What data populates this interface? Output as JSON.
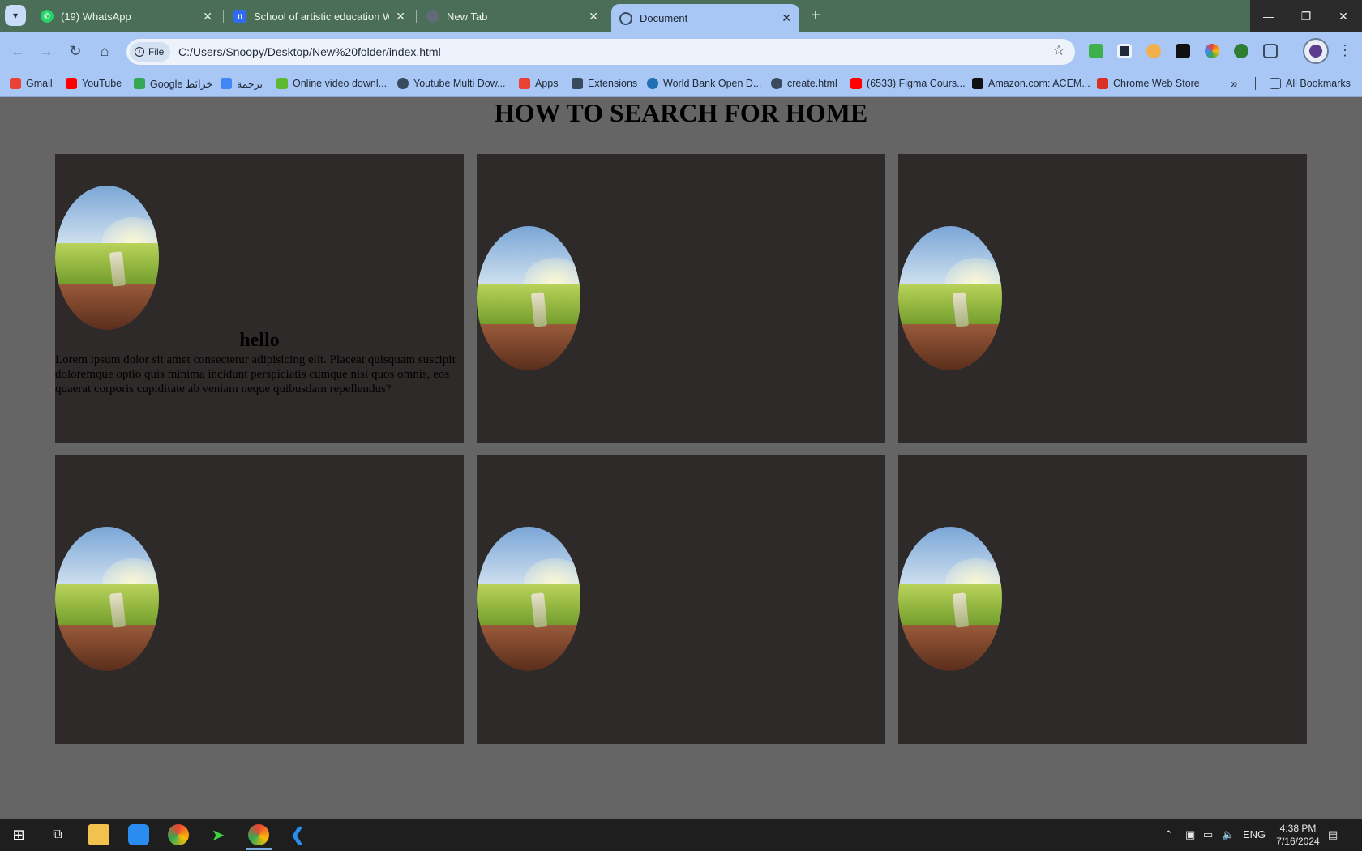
{
  "browser": {
    "tabs": [
      {
        "title": "(19) WhatsApp",
        "icon": "whatsapp-icon",
        "color": "#25d366"
      },
      {
        "title": "School of artistic education Wel",
        "icon": "notion-like-icon",
        "color": "#2f6bf0"
      },
      {
        "title": "New Tab",
        "icon": "globe-icon",
        "color": "#5f6b76"
      },
      {
        "title": "Document",
        "icon": "globe-icon",
        "color": "#3a4a5d"
      }
    ],
    "address_chip": "File",
    "url": "C:/Users/Snoopy/Desktop/New%20folder/index.html",
    "bookmarks": [
      {
        "label": "Gmail",
        "color": "#ea4335"
      },
      {
        "label": "YouTube",
        "color": "#ff0000"
      },
      {
        "label": "Google خرائط",
        "color": "#34a853"
      },
      {
        "label": "ترجمة",
        "color": "#4285f4"
      },
      {
        "label": "Online video downl...",
        "color": "#5fb832"
      },
      {
        "label": "Youtube Multi Dow...",
        "color": "#3a4a5d"
      },
      {
        "label": "Apps",
        "color": "#e94235"
      },
      {
        "label": "Extensions",
        "color": "#3a4a5d"
      },
      {
        "label": "World Bank Open D...",
        "color": "#1f6fb5"
      },
      {
        "label": "create.html",
        "color": "#3a4a5d"
      },
      {
        "label": "(6533) Figma Cours...",
        "color": "#ff0000"
      },
      {
        "label": "Amazon.com: ACEM...",
        "color": "#111111"
      },
      {
        "label": "Chrome Web Store",
        "color": "#d93025"
      }
    ],
    "all_bookmarks": "All Bookmarks"
  },
  "page": {
    "title": "HOW TO SEARCH FOR HOME",
    "cards": [
      {
        "heading": "hello",
        "text": "Lorem ipsum dolor sit amet consectetur adipisicing elit. Placeat quisquam suscipit doloremque optio quis minima incidunt perspiciatis cumque nisi quos omnis, eos quaerat corporis cupiditate ab veniam neque quibusdam repellendus?"
      },
      {
        "heading": "",
        "text": ""
      },
      {
        "heading": "",
        "text": ""
      },
      {
        "heading": "",
        "text": ""
      },
      {
        "heading": "",
        "text": ""
      },
      {
        "heading": "",
        "text": ""
      }
    ]
  },
  "taskbar": {
    "language": "ENG",
    "time": "4:38 PM",
    "date": "7/16/2024"
  }
}
